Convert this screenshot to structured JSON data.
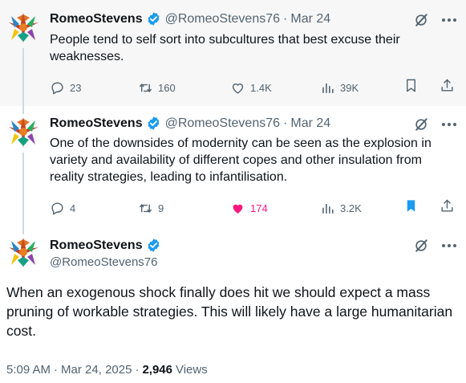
{
  "tweets": [
    {
      "author": "RomeoStevens",
      "handle": "@RomeoStevens76",
      "separator": "·",
      "date": "Mar 24",
      "text": "People tend to self sort into subcultures that best excuse their weaknesses.",
      "replies": "23",
      "retweets": "160",
      "likes": "1.4K",
      "views": "39K",
      "liked": false,
      "bookmarked": false
    },
    {
      "author": "RomeoStevens",
      "handle": "@RomeoStevens76",
      "separator": "·",
      "date": "Mar 24",
      "text": "One of the downsides of modernity can be seen as the explosion in variety and availability of different copes and other insulation from reality strategies, leading to infantilisation.",
      "replies": "4",
      "retweets": "9",
      "likes": "174",
      "views": "3.2K",
      "liked": true,
      "bookmarked": true
    }
  ],
  "focused": {
    "author": "RomeoStevens",
    "handle": "@RomeoStevens76",
    "text": "When an exogenous shock finally does hit we should expect a mass pruning of workable strategies. This will likely have a large humanitarian cost.",
    "time": "5:09 AM",
    "dot": "·",
    "date": "Mar 24, 2025",
    "views_count": "2,946",
    "views_label": "Views"
  },
  "colors": {
    "accent": "#1d9bf0",
    "like": "#f91880",
    "muted": "#536471",
    "highlight_bg": "#f7f7f7"
  },
  "icons": [
    "avatar",
    "verified-badge-icon",
    "grok-icon",
    "more-icon",
    "reply-icon",
    "retweet-icon",
    "like-icon",
    "views-icon",
    "bookmark-icon",
    "share-icon"
  ]
}
